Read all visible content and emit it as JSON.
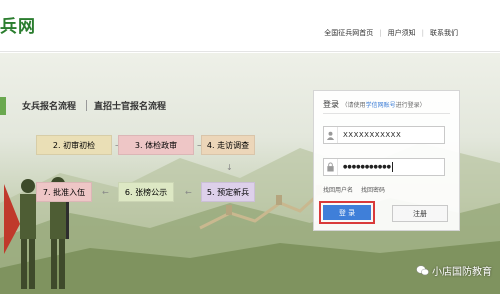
{
  "header": {
    "brand": "兵网",
    "links": [
      "全国征兵网首页",
      "用户须知",
      "联系我们"
    ]
  },
  "tabs": [
    {
      "label": "女兵报名流程"
    },
    {
      "label": "直招士官报名流程"
    }
  ],
  "steps": [
    {
      "label": "2. 初审初检",
      "bg": "#eadfb6"
    },
    {
      "label": "3. 体检政审",
      "bg": "#eec6c6"
    },
    {
      "label": "4. 走访调查",
      "bg": "#ecd6b9"
    },
    {
      "label": "7. 批准入伍",
      "bg": "#eec6c6"
    },
    {
      "label": "6. 张榜公示",
      "bg": "#dde8c4"
    },
    {
      "label": "5. 预定新兵",
      "bg": "#ddd0ea"
    }
  ],
  "login": {
    "title": "登录",
    "subtitle_pre": "（请使用",
    "subtitle_highlight": "学信网账号",
    "subtitle_post": "进行登录）",
    "username_value": "XXXXXXXXXXX",
    "password_value": "●●●●●●●●●●●",
    "find_username": "找回用户名",
    "find_password": "找回密码",
    "login_label": "登 录",
    "register_label": "注册"
  },
  "watermark": "小店国防教育",
  "colors": {
    "brand": "#2a7d2e",
    "login_button": "#3f7fd9",
    "highlight_border": "#d93a3a"
  }
}
